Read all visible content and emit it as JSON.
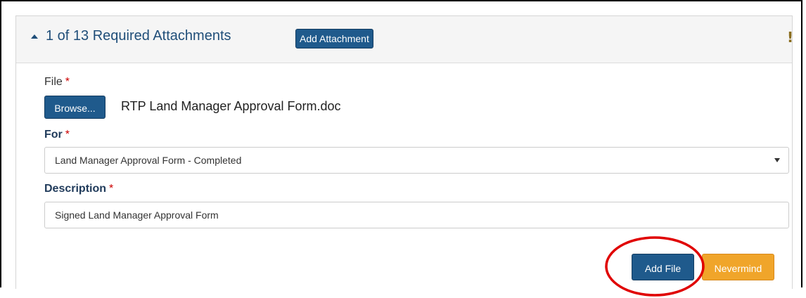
{
  "header": {
    "title": "1 of 13 Required Attachments",
    "add_attachment_label": "Add Attachment"
  },
  "file_field": {
    "label": "File",
    "required_mark": "*",
    "browse_label": "Browse...",
    "selected_file": "RTP Land Manager Approval Form.doc"
  },
  "for_field": {
    "label": "For",
    "required_mark": "*",
    "selected_value": "Land Manager Approval Form - Completed"
  },
  "description_field": {
    "label": "Description",
    "required_mark": "*",
    "value": "Signed Land Manager Approval Form"
  },
  "actions": {
    "add_file_label": "Add File",
    "nevermind_label": "Nevermind"
  },
  "colors": {
    "primary_button": "#1f5a8c",
    "warning_button": "#f0a52a",
    "required_mark": "#cc0000",
    "highlight_circle": "#e00000"
  },
  "icons": {
    "collapse": "caret-up-icon",
    "status": "exclamation-icon",
    "select": "chevron-down-icon"
  }
}
